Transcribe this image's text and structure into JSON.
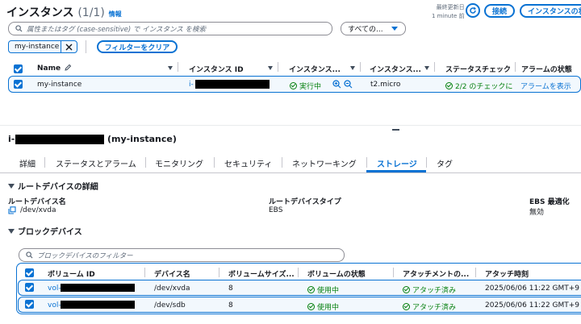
{
  "header": {
    "title": "インスタンス",
    "count": "(1/1)",
    "info_link": "情報",
    "last_updated_label": "最終更新日",
    "last_updated_value": "1 minute 前",
    "connect_button": "接続",
    "state_button": "インスタンスの状"
  },
  "search": {
    "placeholder": "属性またはタグ (case-sensitive) で インスタンス を検索",
    "filter_select": "すべての..."
  },
  "filters": {
    "token": "my-instance",
    "clear_button": "フィルターをクリア"
  },
  "instances_table": {
    "columns": [
      "Name",
      "インスタンス ID",
      "インスタンス...",
      "インスタンス...",
      "ステータスチェック",
      "アラームの状態"
    ],
    "rows": [
      {
        "name": "my-instance",
        "instance_id_prefix": "i-",
        "state": "実行中",
        "type": "t2.micro",
        "status_check": "2/2 のチェックに",
        "alarm": "アラームを表示"
      }
    ]
  },
  "details": {
    "title_prefix": "i-",
    "title_suffix": "(my-instance)",
    "tabs": [
      "詳細",
      "ステータスとアラーム",
      "モニタリング",
      "セキュリティ",
      "ネットワーキング",
      "ストレージ",
      "タグ"
    ],
    "active_tab": "ストレージ",
    "root_section_title": "ルートデバイスの詳細",
    "root_device_name_label": "ルートデバイス名",
    "root_device_name_value": "/dev/xvda",
    "root_device_type_label": "ルートデバイスタイプ",
    "root_device_type_value": "EBS",
    "ebs_opt_label": "EBS 最適化",
    "ebs_opt_value": "無効",
    "block_section_title": "ブロックデバイス",
    "block_filter_placeholder": "ブロックデバイスのフィルター"
  },
  "block_table": {
    "columns": [
      "ボリューム ID",
      "デバイス名",
      "ボリュームサイズ...",
      "ボリュームの状態",
      "アタッチメントの...",
      "アタッチ時刻"
    ],
    "rows": [
      {
        "volume_prefix": "vol-",
        "device": "/dev/xvda",
        "size": "8",
        "state": "使用中",
        "attach": "アタッチ済み",
        "time": "2025/06/06 11:22 GMT+9"
      },
      {
        "volume_prefix": "vol-",
        "device": "/dev/sdb",
        "size": "8",
        "state": "使用中",
        "attach": "アタッチ済み",
        "time": "2025/06/06 11:22 GMT+9"
      }
    ]
  },
  "colors": {
    "accent": "#0972d3",
    "success": "#037f0c",
    "selected_row": "#f2f8fd"
  },
  "icons": [
    "refresh-icon",
    "search-icon",
    "close-icon",
    "edit-icon",
    "sort-icon",
    "zoom-in-icon",
    "zoom-out-icon",
    "copy-icon",
    "check-circle-icon",
    "caret-down-icon"
  ]
}
